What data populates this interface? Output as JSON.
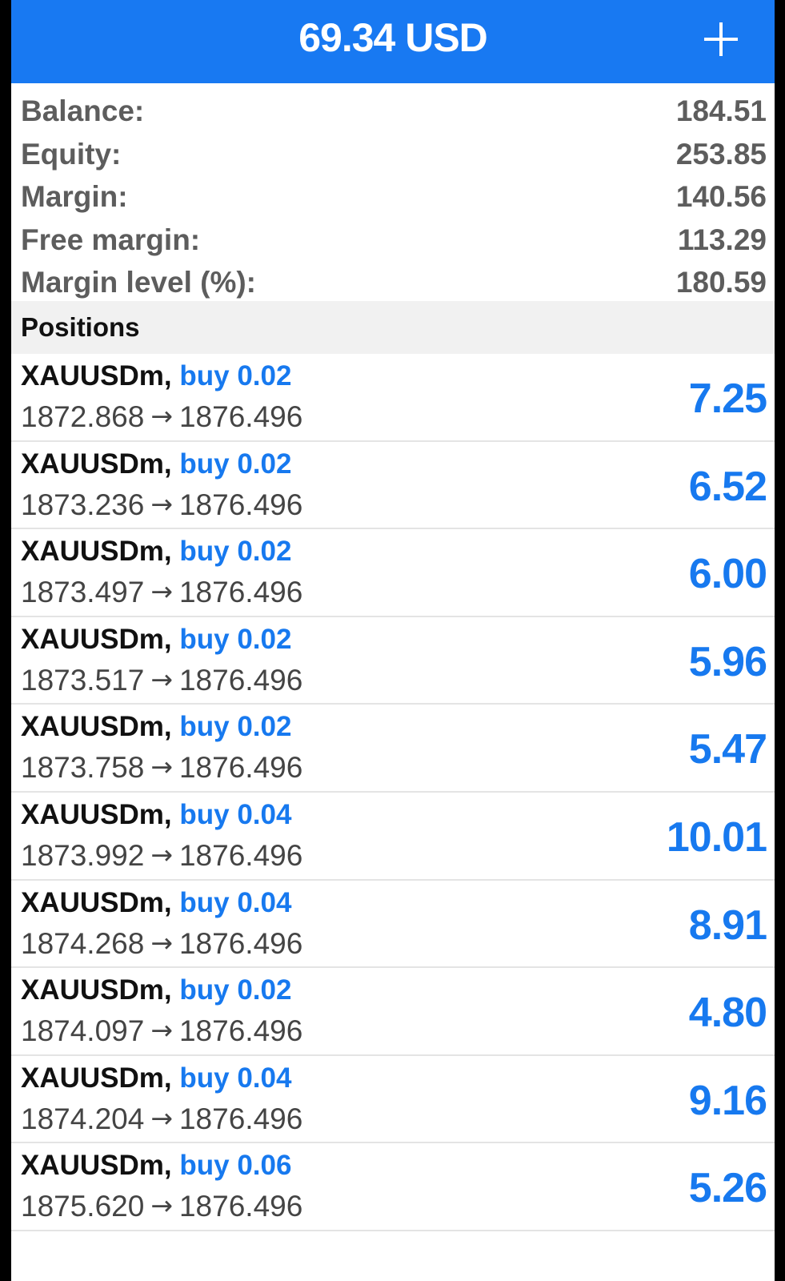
{
  "header": {
    "title": "69.34 USD",
    "add_icon": "plus-icon"
  },
  "summary": [
    {
      "label": "Balance:",
      "value": "184.51"
    },
    {
      "label": "Equity:",
      "value": "253.85"
    },
    {
      "label": "Margin:",
      "value": "140.56"
    },
    {
      "label": "Free margin:",
      "value": "113.29"
    },
    {
      "label": "Margin level (%):",
      "value": "180.59"
    }
  ],
  "positions_section": {
    "title": "Positions"
  },
  "positions": [
    {
      "symbol": "XAUUSDm,",
      "type": "buy 0.02",
      "open": "1872.868",
      "arrow": "→",
      "current": "1876.496",
      "profit": "7.25"
    },
    {
      "symbol": "XAUUSDm,",
      "type": "buy 0.02",
      "open": "1873.236",
      "arrow": "→",
      "current": "1876.496",
      "profit": "6.52"
    },
    {
      "symbol": "XAUUSDm,",
      "type": "buy 0.02",
      "open": "1873.497",
      "arrow": "→",
      "current": "1876.496",
      "profit": "6.00"
    },
    {
      "symbol": "XAUUSDm,",
      "type": "buy 0.02",
      "open": "1873.517",
      "arrow": "→",
      "current": "1876.496",
      "profit": "5.96"
    },
    {
      "symbol": "XAUUSDm,",
      "type": "buy 0.02",
      "open": "1873.758",
      "arrow": "→",
      "current": "1876.496",
      "profit": "5.47"
    },
    {
      "symbol": "XAUUSDm,",
      "type": "buy 0.04",
      "open": "1873.992",
      "arrow": "→",
      "current": "1876.496",
      "profit": "10.01"
    },
    {
      "symbol": "XAUUSDm,",
      "type": "buy 0.04",
      "open": "1874.268",
      "arrow": "→",
      "current": "1876.496",
      "profit": "8.91"
    },
    {
      "symbol": "XAUUSDm,",
      "type": "buy 0.02",
      "open": "1874.097",
      "arrow": "→",
      "current": "1876.496",
      "profit": "4.80"
    },
    {
      "symbol": "XAUUSDm,",
      "type": "buy 0.04",
      "open": "1874.204",
      "arrow": "→",
      "current": "1876.496",
      "profit": "9.16"
    },
    {
      "symbol": "XAUUSDm,",
      "type": "buy 0.06",
      "open": "1875.620",
      "arrow": "→",
      "current": "1876.496",
      "profit": "5.26"
    }
  ],
  "colors": {
    "header_bg": "#1879f2",
    "accent_blue": "#1779ef",
    "label_gray": "#5d5d5d",
    "section_bg": "#f1f1f1"
  }
}
